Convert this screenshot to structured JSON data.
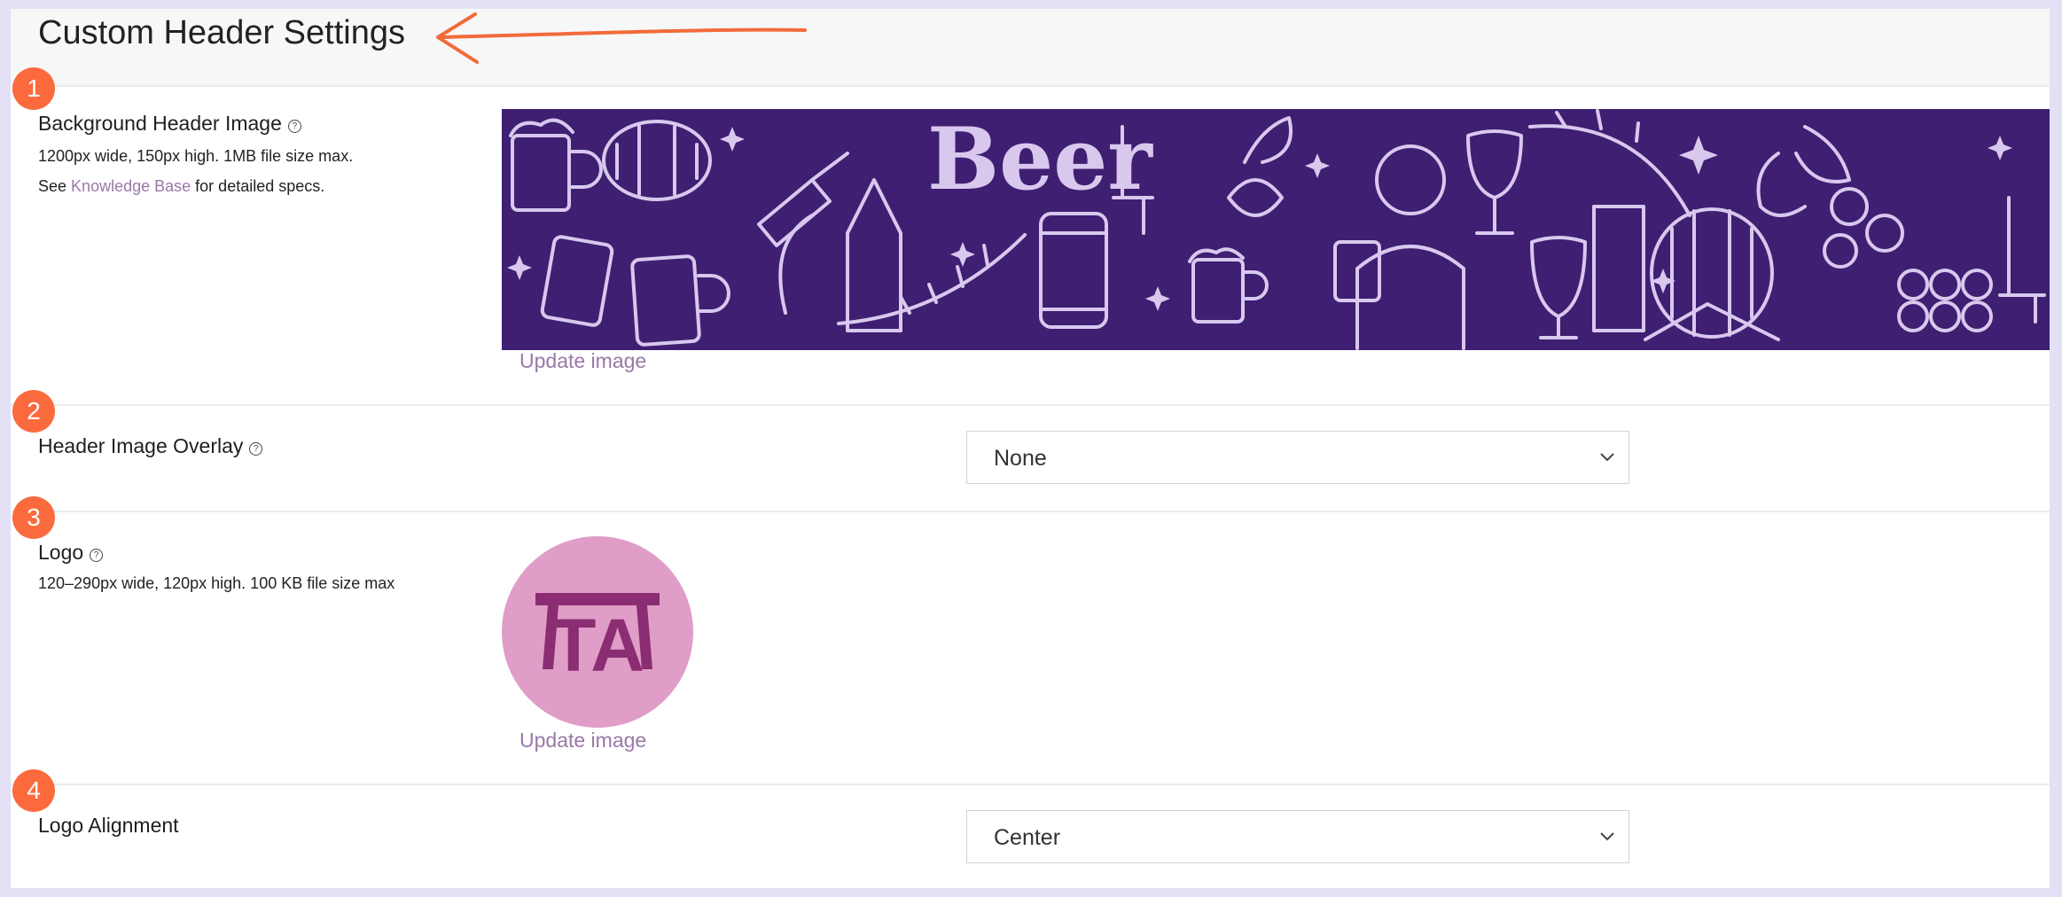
{
  "page": {
    "title": "Custom Header Settings"
  },
  "colors": {
    "accent_badge": "#fb6a3d",
    "link": "#9a78a8",
    "banner_bg": "#3e1f72",
    "logo_bg": "#e09dc7",
    "logo_fg": "#8a2d72",
    "annotation_arrow": "#f26b3a"
  },
  "sections": {
    "background_image": {
      "badge": "1",
      "label": "Background Header Image",
      "help_icon": "question-circle-icon",
      "hint_size": "1200px wide, 150px high. 1MB file size max.",
      "hint_see": "See",
      "hint_link": "Knowledge Base",
      "hint_after": "for detailed specs.",
      "banner_text": "Beer",
      "update_label": "Update image"
    },
    "overlay": {
      "badge": "2",
      "label": "Header Image Overlay",
      "help_icon": "question-circle-icon",
      "selected": "None"
    },
    "logo": {
      "badge": "3",
      "label": "Logo",
      "help_icon": "question-circle-icon",
      "hint": "120–290px wide, 120px high. 100 KB file size max",
      "logo_text": "TA",
      "update_label": "Update image"
    },
    "logo_alignment": {
      "badge": "4",
      "label": "Logo Alignment",
      "selected": "Center"
    }
  }
}
